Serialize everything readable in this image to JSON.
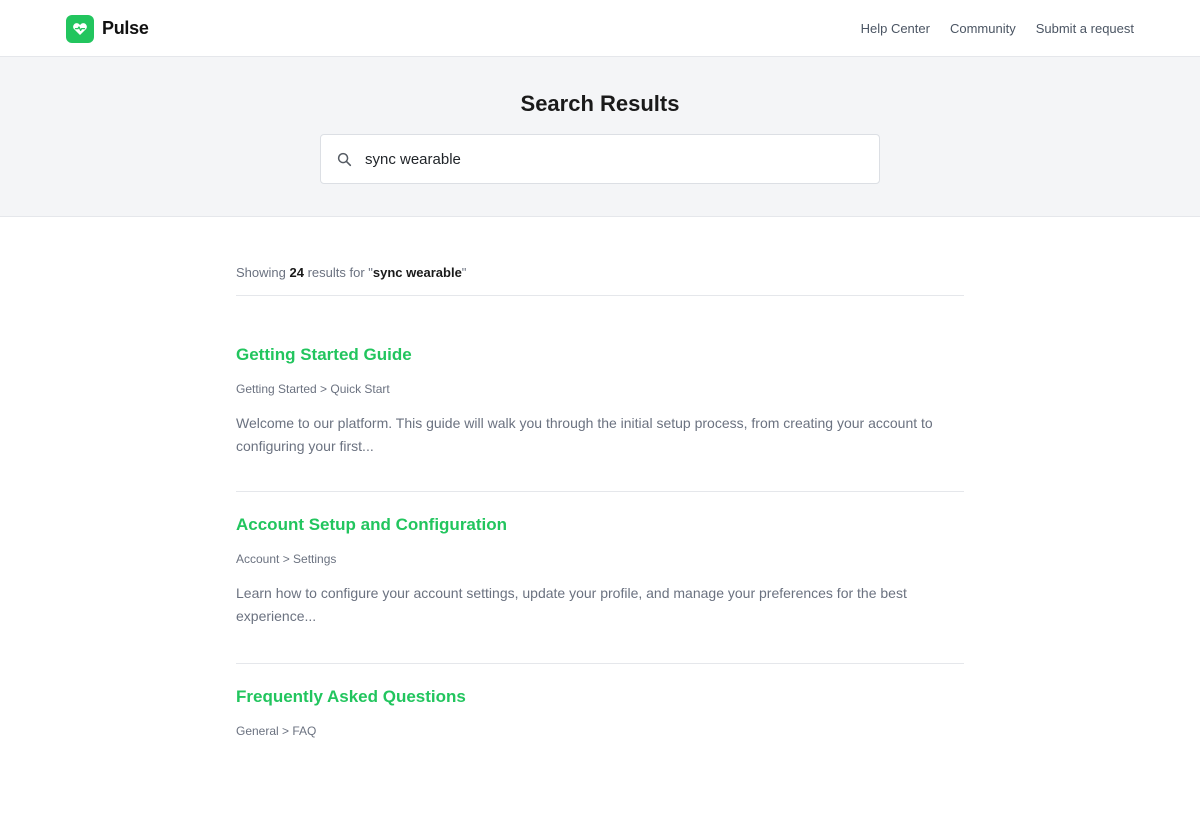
{
  "brand": {
    "name": "Pulse",
    "icon": "heart-pulse-icon",
    "accent_color": "#22c55e"
  },
  "nav": {
    "links": [
      {
        "label": "Help Center"
      },
      {
        "label": "Community"
      },
      {
        "label": "Submit a request"
      }
    ]
  },
  "hero": {
    "title": "Search Results"
  },
  "search": {
    "value": "sync wearable",
    "icon": "search-icon"
  },
  "summary": {
    "prefix": "Showing",
    "count": "24",
    "middle": "results for \"",
    "query": "sync wearable",
    "suffix": "\""
  },
  "results": [
    {
      "title": "Getting Started Guide",
      "breadcrumb": "Getting Started > Quick Start",
      "excerpt": "Welcome to our platform. This guide will walk you through the initial setup process, from creating your account to configuring your first..."
    },
    {
      "title": "Account Setup and Configuration",
      "breadcrumb": "Account > Settings",
      "excerpt": "Learn how to configure your account settings, update your profile, and manage your preferences for the best experience..."
    },
    {
      "title": "Frequently Asked Questions",
      "breadcrumb": "General > FAQ",
      "excerpt": ""
    }
  ]
}
